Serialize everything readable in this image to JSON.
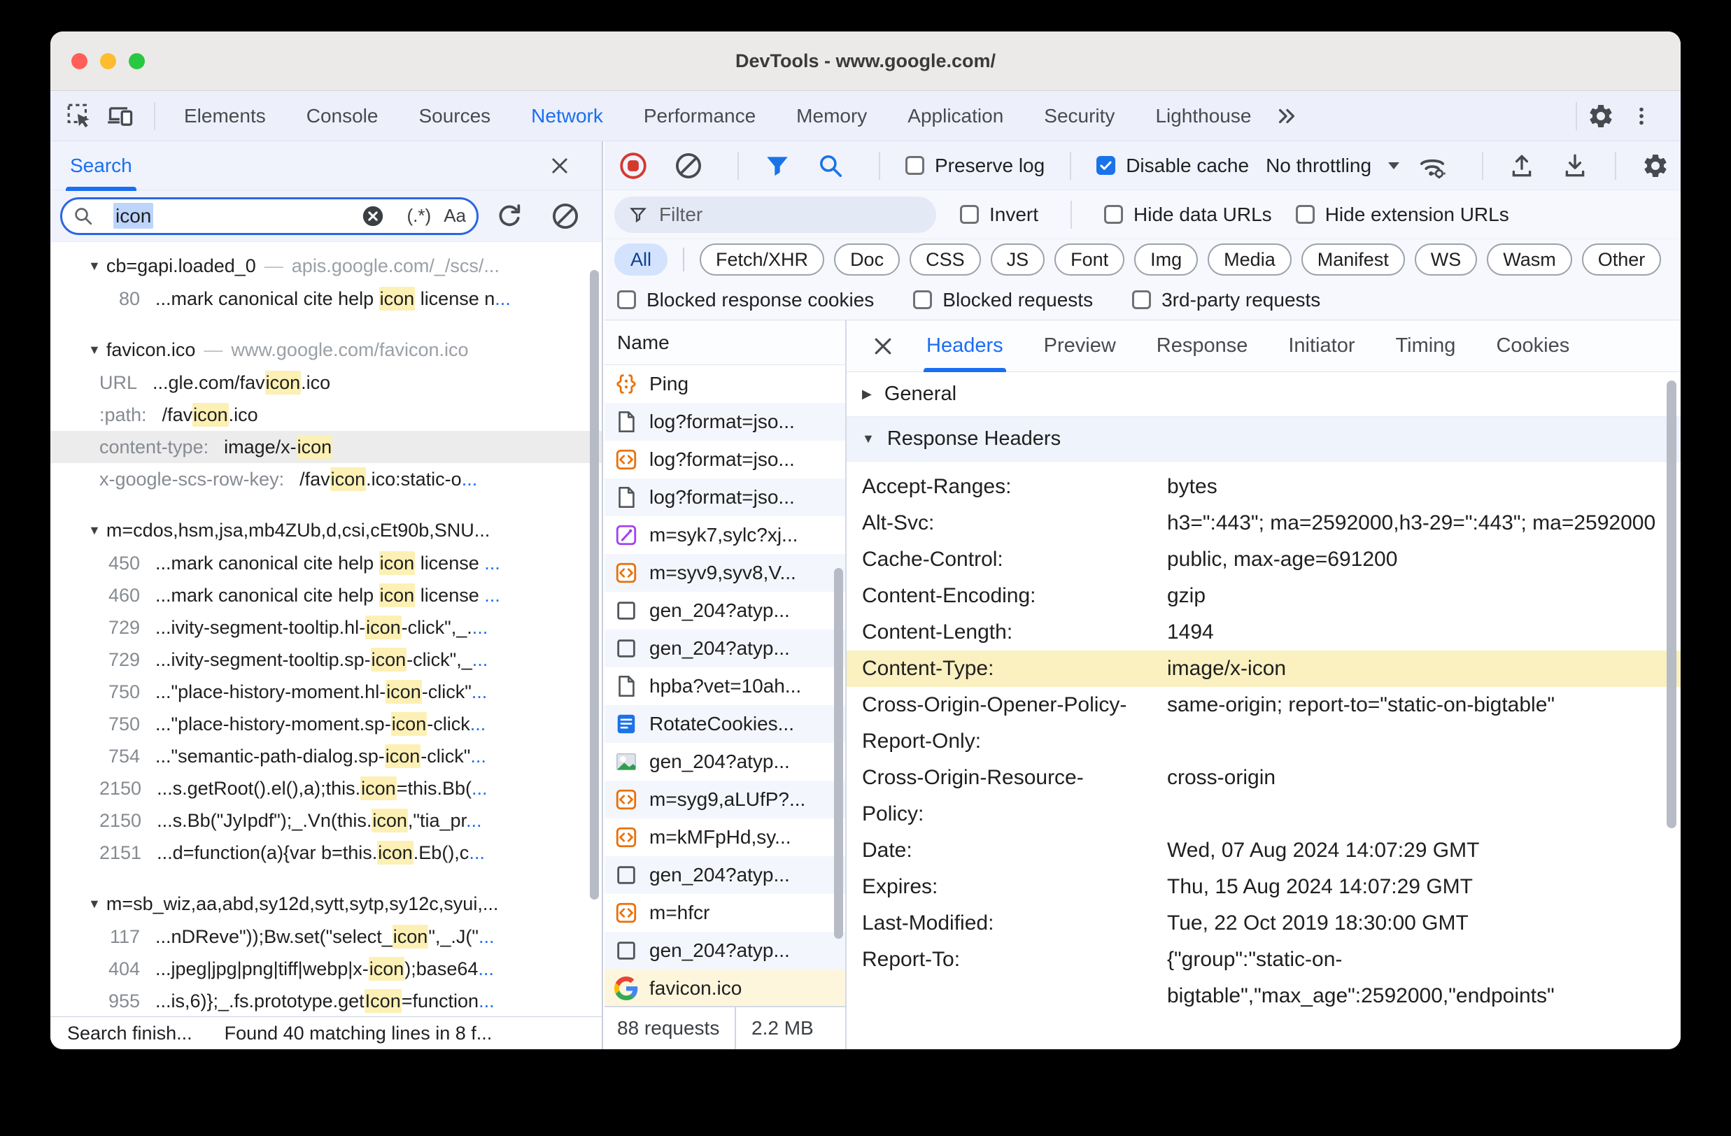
{
  "window": {
    "title": "DevTools - www.google.com/",
    "tabs": [
      "Elements",
      "Console",
      "Sources",
      "Network",
      "Performance",
      "Memory",
      "Application",
      "Security",
      "Lighthouse"
    ],
    "active_tab": "Network"
  },
  "search_panel": {
    "tab_label": "Search",
    "query": "icon",
    "regex_button": "(.*)",
    "case_button": "Aa",
    "sections": [
      {
        "name": "cb=gapi.loaded_0",
        "url": "apis.google.com/_/scs/...",
        "matches": [
          {
            "label": "80",
            "segs": [
              [
                "...mark canonical cite help "
              ],
              [
                "icon",
                "hl"
              ],
              [
                " license n"
              ],
              [
                "...",
                "more"
              ]
            ]
          }
        ]
      },
      {
        "name": "favicon.ico",
        "url": "www.google.com/favicon.ico",
        "matches": [
          {
            "label": "URL",
            "segs": [
              [
                "...gle.com/fav"
              ],
              [
                "icon",
                "hl"
              ],
              [
                ".ico"
              ]
            ]
          },
          {
            "label": ":path:",
            "segs": [
              [
                "/fav"
              ],
              [
                "icon",
                "hl"
              ],
              [
                ".ico"
              ]
            ]
          },
          {
            "label": "content-type:",
            "selected": true,
            "segs": [
              [
                "image/x-"
              ],
              [
                "icon",
                "hl"
              ]
            ]
          },
          {
            "label": "x-google-scs-row-key:",
            "segs": [
              [
                "/fav"
              ],
              [
                "icon",
                "hl"
              ],
              [
                ".ico:static-o"
              ],
              [
                "...",
                "more"
              ]
            ]
          }
        ]
      },
      {
        "name": "m=cdos,hsm,jsa,mb4ZUb,d,csi,cEt90b,SNU...",
        "url": "",
        "matches": [
          {
            "label": "450",
            "segs": [
              [
                "...mark canonical cite help "
              ],
              [
                "icon",
                "hl"
              ],
              [
                " license "
              ],
              [
                "...",
                "more"
              ]
            ]
          },
          {
            "label": "460",
            "segs": [
              [
                "...mark canonical cite help "
              ],
              [
                "icon",
                "hl"
              ],
              [
                " license "
              ],
              [
                "...",
                "more"
              ]
            ]
          },
          {
            "label": "729",
            "segs": [
              [
                "...ivity-segment-tooltip.hl-"
              ],
              [
                "icon",
                "hl"
              ],
              [
                "-click\",_."
              ],
              [
                "...",
                "more"
              ]
            ]
          },
          {
            "label": "729",
            "segs": [
              [
                "...ivity-segment-tooltip.sp-"
              ],
              [
                "icon",
                "hl"
              ],
              [
                "-click\",_"
              ],
              [
                "...",
                "more"
              ]
            ]
          },
          {
            "label": "750",
            "segs": [
              [
                "...\"place-history-moment.hl-"
              ],
              [
                "icon",
                "hl"
              ],
              [
                "-click\""
              ],
              [
                "...",
                "more"
              ]
            ]
          },
          {
            "label": "750",
            "segs": [
              [
                "...\"place-history-moment.sp-"
              ],
              [
                "icon",
                "hl"
              ],
              [
                "-click"
              ],
              [
                "...",
                "more"
              ]
            ]
          },
          {
            "label": "754",
            "segs": [
              [
                "...\"semantic-path-dialog.sp-"
              ],
              [
                "icon",
                "hl"
              ],
              [
                "-click\""
              ],
              [
                "...",
                "more"
              ]
            ]
          },
          {
            "label": "2150",
            "segs": [
              [
                "...s.getRoot().el(),a);this."
              ],
              [
                "icon",
                "hl"
              ],
              [
                "=this.Bb("
              ],
              [
                "...",
                "more"
              ]
            ]
          },
          {
            "label": "2150",
            "segs": [
              [
                "...s.Bb(\"JyIpdf\");_.Vn(this."
              ],
              [
                "icon",
                "hl"
              ],
              [
                ",\"tia_pr"
              ],
              [
                "...",
                "more"
              ]
            ]
          },
          {
            "label": "2151",
            "segs": [
              [
                "...d=function(a){var b=this."
              ],
              [
                "icon",
                "hl"
              ],
              [
                ".Eb(),c"
              ],
              [
                "...",
                "more"
              ]
            ]
          }
        ]
      },
      {
        "name": "m=sb_wiz,aa,abd,sy12d,sytt,sytp,sy12c,syui,...",
        "url": "",
        "matches": [
          {
            "label": "117",
            "segs": [
              [
                "...nDReve\"));Bw.set(\"select_"
              ],
              [
                "icon",
                "hl"
              ],
              [
                "\",_.J(\""
              ],
              [
                "...",
                "more"
              ]
            ]
          },
          {
            "label": "404",
            "segs": [
              [
                "...jpeg|jpg|png|tiff|webp|x-"
              ],
              [
                "icon",
                "hl"
              ],
              [
                ");base64"
              ],
              [
                "...",
                "more"
              ]
            ]
          },
          {
            "label": "955",
            "segs": [
              [
                "...is,6)};_.fs.prototype.get"
              ],
              [
                "Icon",
                "hl"
              ],
              [
                "=function"
              ],
              [
                "...",
                "more"
              ]
            ]
          }
        ]
      }
    ],
    "status_left": "Search finish...",
    "status_right": "Found 40 matching lines in 8 f..."
  },
  "network": {
    "toolbar": {
      "preserve_log": "Preserve log",
      "disable_cache": "Disable cache",
      "throttling": "No throttling"
    },
    "filter_placeholder": "Filter",
    "invert_label": "Invert",
    "hide_data_urls": "Hide data URLs",
    "hide_extension_urls": "Hide extension URLs",
    "chips": [
      "All",
      "Fetch/XHR",
      "Doc",
      "CSS",
      "JS",
      "Font",
      "Img",
      "Media",
      "Manifest",
      "WS",
      "Wasm",
      "Other"
    ],
    "active_chip": "All",
    "blocked": [
      "Blocked response cookies",
      "Blocked requests",
      "3rd-party requests"
    ],
    "name_header": "Name",
    "requests": [
      {
        "icon": "ping",
        "name": "Ping"
      },
      {
        "icon": "doc",
        "name": "log?format=jso..."
      },
      {
        "icon": "script",
        "name": "log?format=jso..."
      },
      {
        "icon": "doc",
        "name": "log?format=jso..."
      },
      {
        "icon": "css",
        "name": "m=syk7,sylc?xj..."
      },
      {
        "icon": "script",
        "name": "m=syv9,syv8,V..."
      },
      {
        "icon": "square",
        "name": "gen_204?atyp..."
      },
      {
        "icon": "square",
        "name": "gen_204?atyp..."
      },
      {
        "icon": "doc",
        "name": "hpba?vet=10ah..."
      },
      {
        "icon": "docblue",
        "name": "RotateCookies..."
      },
      {
        "icon": "image",
        "name": "gen_204?atyp..."
      },
      {
        "icon": "script",
        "name": "m=syg9,aLUfP?..."
      },
      {
        "icon": "script",
        "name": "m=kMFpHd,sy..."
      },
      {
        "icon": "square",
        "name": "gen_204?atyp..."
      },
      {
        "icon": "script",
        "name": "m=hfcr"
      },
      {
        "icon": "square",
        "name": "gen_204?atyp..."
      },
      {
        "icon": "google",
        "name": "favicon.ico",
        "selected": true
      }
    ],
    "footer": {
      "requests": "88 requests",
      "size": "2.2 MB"
    }
  },
  "details": {
    "tabs": [
      "Headers",
      "Preview",
      "Response",
      "Initiator",
      "Timing",
      "Cookies"
    ],
    "active_tab": "Headers",
    "general_label": "General",
    "response_headers_label": "Response Headers",
    "headers": [
      {
        "name": "Accept-Ranges:",
        "value": "bytes"
      },
      {
        "name": "Alt-Svc:",
        "value": "h3=\":443\"; ma=2592000,h3-29=\":443\"; ma=2592000"
      },
      {
        "name": "Cache-Control:",
        "value": "public, max-age=691200"
      },
      {
        "name": "Content-Encoding:",
        "value": "gzip"
      },
      {
        "name": "Content-Length:",
        "value": "1494"
      },
      {
        "name": "Content-Type:",
        "value": "image/x-icon",
        "highlight": true
      },
      {
        "name": "Cross-Origin-Opener-Policy-Report-Only:",
        "value": "same-origin; report-to=\"static-on-bigtable\""
      },
      {
        "name": "Cross-Origin-Resource-Policy:",
        "value": "cross-origin"
      },
      {
        "name": "Date:",
        "value": "Wed, 07 Aug 2024 14:07:29 GMT"
      },
      {
        "name": "Expires:",
        "value": "Thu, 15 Aug 2024 14:07:29 GMT"
      },
      {
        "name": "Last-Modified:",
        "value": "Tue, 22 Oct 2019 18:30:00 GMT"
      },
      {
        "name": "Report-To:",
        "value": "{\"group\":\"static-on-bigtable\",\"max_age\":2592000,\"endpoints\""
      }
    ]
  }
}
